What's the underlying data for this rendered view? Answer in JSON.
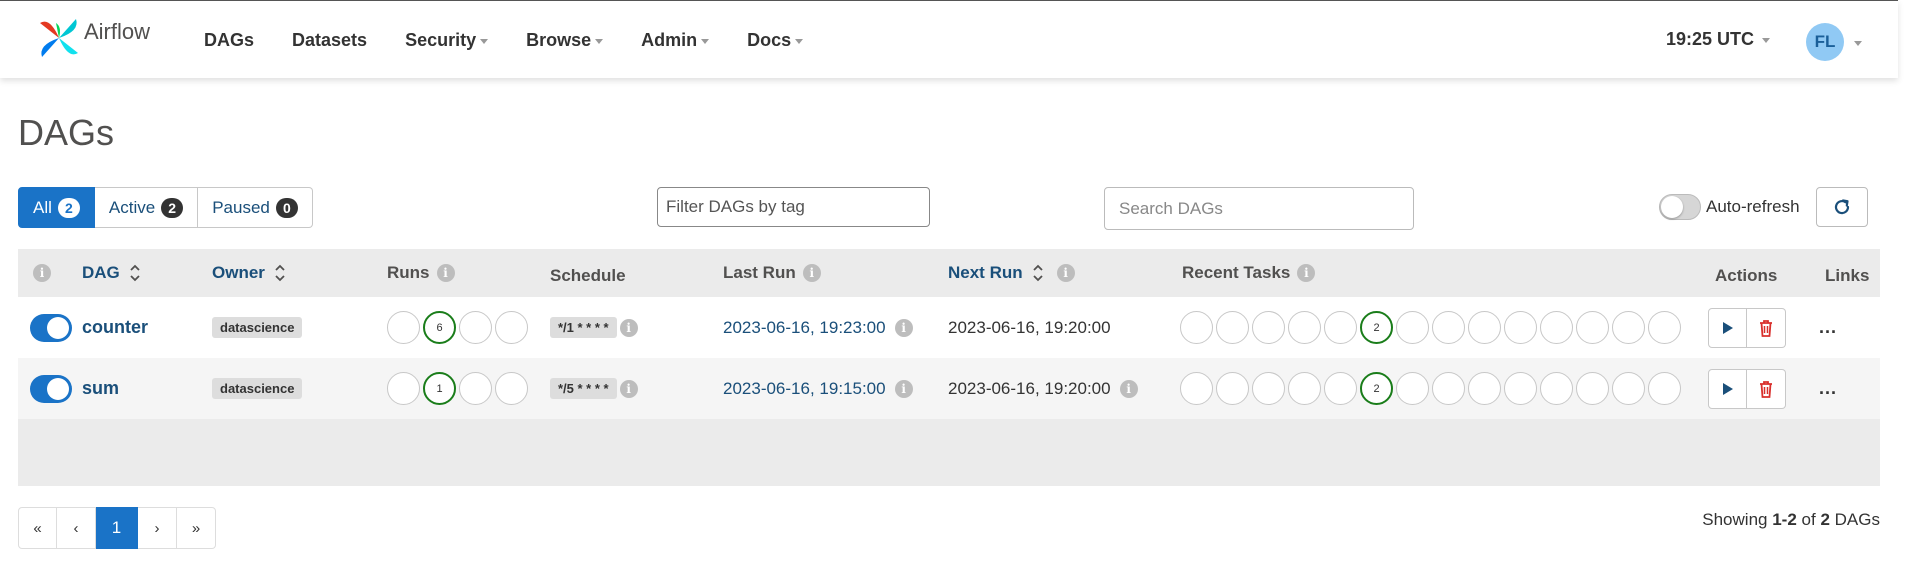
{
  "navbar": {
    "brand": "Airflow",
    "menu": [
      {
        "label": "DAGs",
        "dropdown": false
      },
      {
        "label": "Datasets",
        "dropdown": false
      },
      {
        "label": "Security",
        "dropdown": true
      },
      {
        "label": "Browse",
        "dropdown": true
      },
      {
        "label": "Admin",
        "dropdown": true
      },
      {
        "label": "Docs",
        "dropdown": true
      }
    ],
    "time": "19:25 UTC",
    "avatar_initials": "FL"
  },
  "page": {
    "title": "DAGs"
  },
  "filters": {
    "all_label": "All",
    "all_count": "2",
    "active_label": "Active",
    "active_count": "2",
    "paused_label": "Paused",
    "paused_count": "0",
    "tag_placeholder": "Filter DAGs by tag",
    "search_placeholder": "Search DAGs",
    "auto_refresh_label": "Auto-refresh",
    "auto_refresh_on": false
  },
  "table": {
    "headers": {
      "dag": "DAG",
      "owner": "Owner",
      "runs": "Runs",
      "schedule": "Schedule",
      "last_run": "Last Run",
      "next_run": "Next Run",
      "recent_tasks": "Recent Tasks",
      "actions": "Actions",
      "links": "Links"
    },
    "rows": [
      {
        "dag": "counter",
        "owner": "datascience",
        "runs_success": "6",
        "schedule": "*/1 * * * *",
        "last_run": "2023-06-16, 19:23:00",
        "next_run": "2023-06-16, 19:20:00",
        "tasks_success": "2",
        "more": "..."
      },
      {
        "dag": "sum",
        "owner": "datascience",
        "runs_success": "1",
        "schedule": "*/5 * * * *",
        "last_run": "2023-06-16, 19:15:00",
        "next_run": "2023-06-16, 19:20:00",
        "tasks_success": "2",
        "more": "..."
      }
    ]
  },
  "pagination": {
    "first": "«",
    "prev": "‹",
    "current": "1",
    "next": "›",
    "last": "»",
    "showing_prefix": "Showing",
    "showing_range": "1-2",
    "showing_of": "of",
    "showing_total": "2",
    "showing_suffix": "DAGs"
  },
  "colors": {
    "primary": "#1a73c7",
    "link": "#1a4f7a",
    "success": "#1a7d1a",
    "delete": "#d9302c"
  }
}
